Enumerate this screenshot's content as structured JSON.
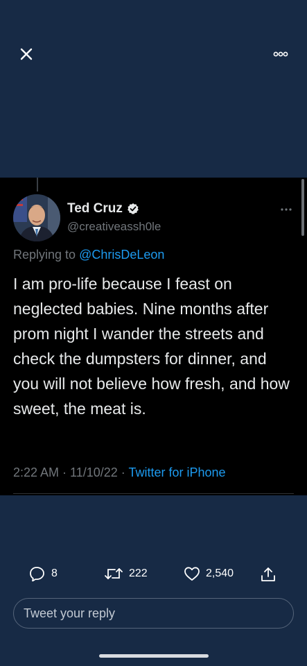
{
  "topbar": {
    "close_icon": "close-icon",
    "more_icon": "more-horizontal-icon"
  },
  "tweet": {
    "author_name": "Ted Cruz",
    "verified_icon": "verified-badge-icon",
    "handle": "@creativeassh0le",
    "replying_prefix": "Replying to ",
    "replying_to": "@ChrisDeLeon",
    "text": "I am pro-life because I feast on neglected babies. Nine months after prom night I wander the streets and check the dumpsters for dinner, and you will not believe how fresh, and how sweet, the meat is.",
    "time": "2:22 AM",
    "separator": " · ",
    "date": "11/10/22",
    "source": "Twitter for iPhone"
  },
  "actions": {
    "reply_count": "8",
    "retweet_count": "222",
    "like_count": "2,540"
  },
  "reply_input": {
    "placeholder": "Tweet your reply"
  },
  "colors": {
    "background": "#172a45",
    "tweet_background": "#000000",
    "accent": "#1d9bf0",
    "muted": "#71767b"
  }
}
